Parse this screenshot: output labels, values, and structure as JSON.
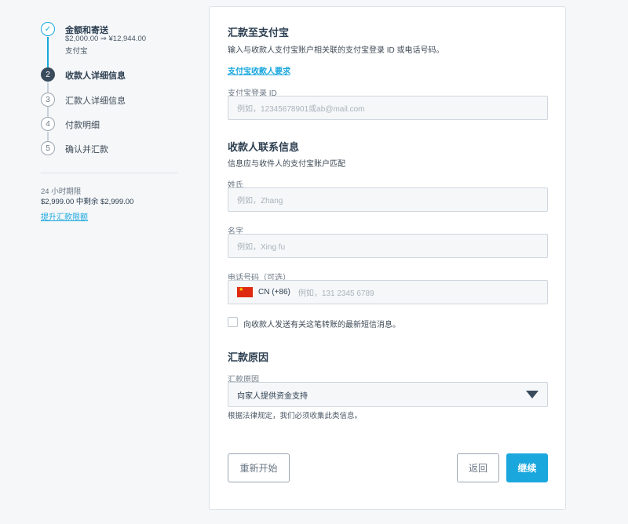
{
  "sidebar": {
    "steps": [
      {
        "number": "✓",
        "title": "金额和寄送",
        "sub1": "$2,000.00 ⇒ ¥12,944.00",
        "sub2": "支付宝"
      },
      {
        "number": "2",
        "title": "收款人详细信息"
      },
      {
        "number": "3",
        "title": "汇款人详细信息"
      },
      {
        "number": "4",
        "title": "付款明细"
      },
      {
        "number": "5",
        "title": "确认并汇款"
      }
    ],
    "limit_title": "24 小时期限",
    "limit_value": "$2,999.00 中剩余 $2,999.00",
    "limit_link": "提升汇款限额"
  },
  "form": {
    "section1_title": "汇款至支付宝",
    "section1_desc": "输入与收款人支付宝账户相关联的支付宝登录 ID 或电话号码。",
    "requirements_link": "支付宝收款人要求",
    "alipay_label": "支付宝登录 ID",
    "alipay_placeholder": "例如，12345678901或ab@mail.com",
    "section2_title": "收款人联系信息",
    "section2_desc": "信息应与收件人的支付宝账户匹配",
    "surname_label": "姓氏",
    "surname_placeholder": "例如，Zhang",
    "given_label": "名字",
    "given_placeholder": "例如，Xing fu",
    "phone_label": "电话号码（可选）",
    "phone_country": "CN (+86)",
    "phone_placeholder": "例如，131 2345 6789",
    "sms_label": "向收款人发送有关这笔转账的最新短信消息。",
    "section3_title": "汇款原因",
    "reason_label": "汇款原因",
    "reason_value": "向家人提供资金支持",
    "reason_note": "根据法律规定，我们必须收集此类信息。",
    "restart_button": "重新开始",
    "back_button": "返回",
    "continue_button": "继续"
  },
  "colors": {
    "accent": "#1aa7de",
    "active_step": "#394b5c"
  }
}
